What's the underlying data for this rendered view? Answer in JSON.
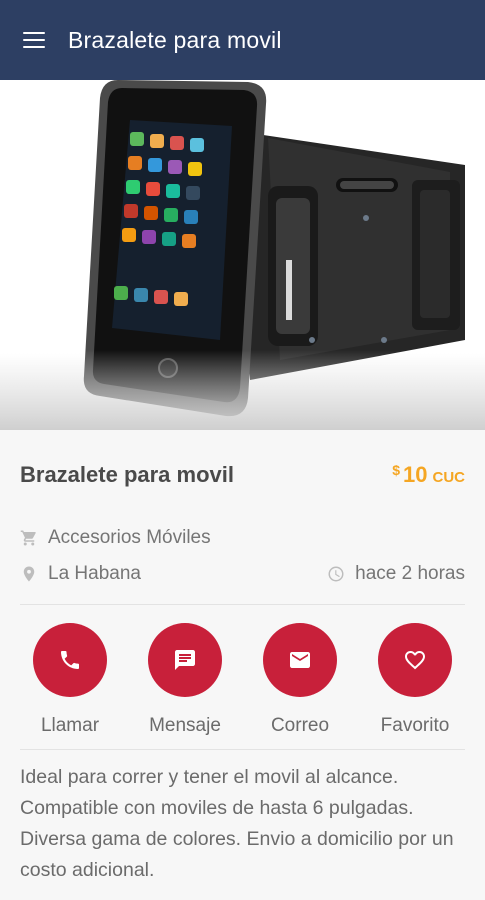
{
  "appbar": {
    "title": "Brazalete para movil",
    "menu_icon": "menu-icon"
  },
  "product": {
    "title": "Brazalete para movil",
    "price": {
      "symbol": "$",
      "amount": "10",
      "currency": "CUC"
    },
    "category": "Accesorios Móviles",
    "location": "La Habana",
    "posted": "hace 2 horas",
    "description": "Ideal para correr y tener el movil al alcance. Compatible con moviles de hasta 6 pulgadas. Diversa gama de colores. Envio a domicilio por un costo adicional."
  },
  "actions": [
    {
      "label": "Llamar",
      "icon": "phone-icon"
    },
    {
      "label": "Mensaje",
      "icon": "message-icon"
    },
    {
      "label": "Correo",
      "icon": "mail-icon"
    },
    {
      "label": "Favorito",
      "icon": "heart-icon"
    }
  ],
  "colors": {
    "appbar": "#2d3f63",
    "accent": "#c8203a",
    "price": "#f5a623"
  }
}
